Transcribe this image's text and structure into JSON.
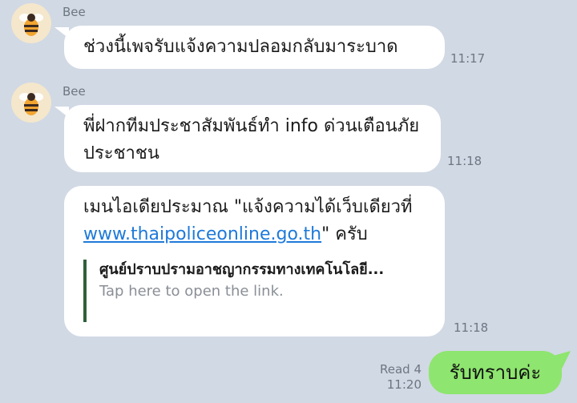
{
  "messages": [
    {
      "sender": "Bee",
      "text": "ช่วงนี้เพจรับแจ้งความปลอมกลับมาระบาด",
      "time": "11:17"
    },
    {
      "sender": "Bee",
      "text": "พี่ฝากทีมประชาสัมพันธ์ทำ info ด่วนเตือนภัยประชาชน",
      "time": "11:18"
    },
    {
      "sender": "Bee",
      "text_pre": "เมนไอเดียประมาณ \"แจ้งความได้เว็บเดียวที่ ",
      "link": "www.thaipoliceonline.go.th",
      "text_post": "\" ครับ",
      "preview_title": "ศูนย์ปราบปรามอาชญากรรมทางเทคโนโลยี...",
      "preview_subtitle": "Tap here to open the link.",
      "time": "11:18"
    }
  ],
  "outgoing": {
    "text": "รับทราบค่ะ",
    "read": "Read 4",
    "time": "11:20"
  },
  "colors": {
    "background": "#d1d9e4",
    "incoming": "#ffffff",
    "outgoing": "#8ee56f",
    "link": "#1e7ad9"
  }
}
